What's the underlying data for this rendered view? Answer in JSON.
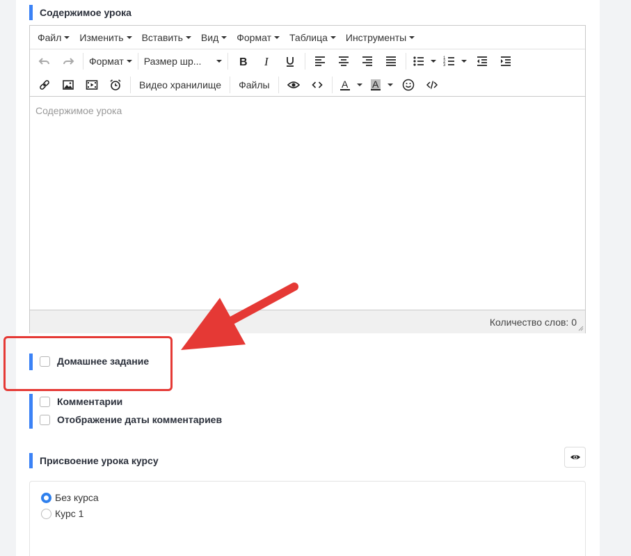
{
  "lesson_content": {
    "title": "Содержимое урока",
    "menu": [
      "Файл",
      "Изменить",
      "Вставить",
      "Вид",
      "Формат",
      "Таблица",
      "Инструменты"
    ],
    "toolbar": {
      "format_dropdown": "Формат",
      "font_size_dropdown": "Размер шр...",
      "video_storage": "Видео хранилище",
      "files": "Файлы"
    },
    "placeholder": "Содержимое урока",
    "word_count": "Количество слов: 0"
  },
  "homework": {
    "label": "Домашнее задание",
    "checked": false
  },
  "comments": {
    "label": "Комментарии",
    "checked": false
  },
  "comment_dates": {
    "label": "Отображение даты комментариев",
    "checked": false
  },
  "course_assign": {
    "title": "Присвоение урока курсу",
    "options": [
      {
        "label": "Без курса",
        "checked": true
      },
      {
        "label": "Курс 1",
        "checked": false
      }
    ]
  },
  "colors": {
    "accent": "#3b82f6",
    "annotation": "#e53935",
    "radio": "#2f80ed"
  }
}
